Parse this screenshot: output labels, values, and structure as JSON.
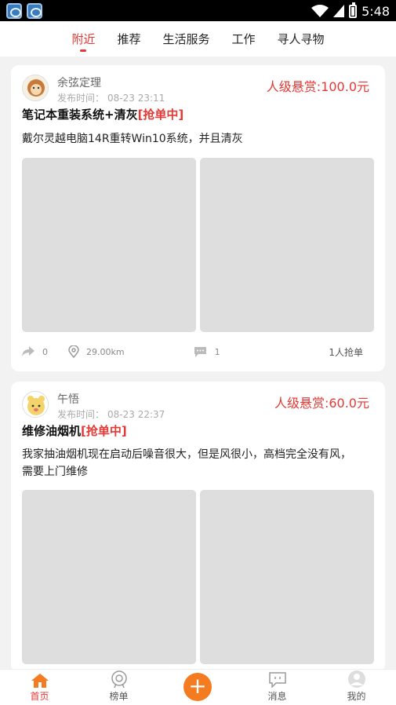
{
  "status_bar": {
    "time": "5:48"
  },
  "tabs": [
    "附近",
    "推荐",
    "生活服务",
    "工作",
    "寻人寻物"
  ],
  "posts": [
    {
      "username": "余弦定理",
      "publish_label": "发布时间：",
      "publish_time": "08-23 23:11",
      "reward": "人级悬赏:100.0元",
      "title": "笔记本重装系统+清灰",
      "status_tag": "[抢单中]",
      "description": "戴尔灵越电脑14R重转Win10系统，并且清灰",
      "shares": "0",
      "distance": "29.00km",
      "comments": "1",
      "grab_count": "1人抢单"
    },
    {
      "username": "午悟",
      "publish_label": "发布时间：",
      "publish_time": "08-23 22:37",
      "reward": "人级悬赏:60.0元",
      "title": "维修油烟机",
      "status_tag": "[抢单中]",
      "description": "我家抽油烟机现在启动后噪音很大，但是风很小，高档完全没有风，需要上门维修"
    }
  ],
  "bottom_nav": {
    "home": "首页",
    "ranking": "榜单",
    "messages": "消息",
    "mine": "我的"
  },
  "colors": {
    "accent": "#e53935",
    "plus_button": "#f47b20"
  }
}
